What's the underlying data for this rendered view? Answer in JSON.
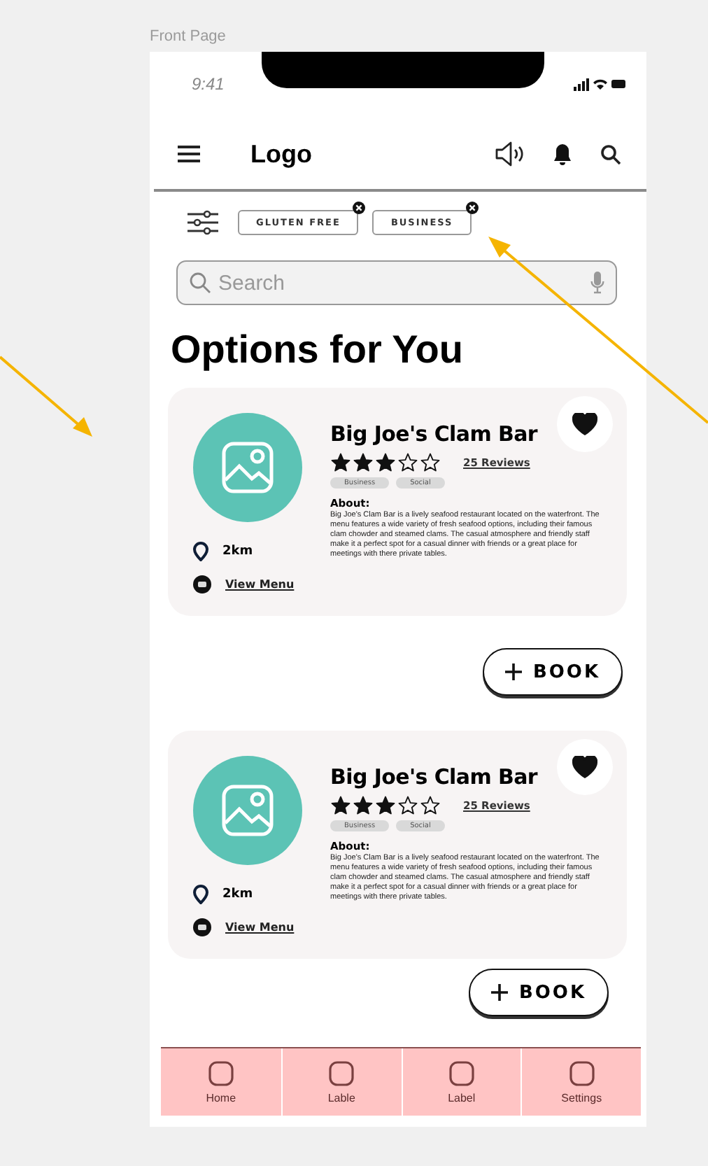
{
  "frame_label": "Front Page",
  "status_bar": {
    "time": "9:41"
  },
  "header": {
    "logo": "Logo"
  },
  "filters": [
    {
      "label": "GLUTEN FREE"
    },
    {
      "label": "BUSINESS"
    }
  ],
  "search": {
    "placeholder": "Search"
  },
  "heading": "Options for You",
  "cards": [
    {
      "name": "Big Joe's Clam Bar",
      "stars": 3,
      "reviews": "25 Reviews",
      "tags": [
        "Business",
        "Social"
      ],
      "favorite": true,
      "distance": "2km",
      "menu_link": "View Menu",
      "about_title": "About:",
      "about": "Big Joe's Clam Bar is a lively seafood restaurant located on the waterfront. The menu features a wide variety of fresh seafood options, including their famous clam chowder and steamed clams. The casual atmosphere and friendly staff make it a perfect spot for a casual dinner with friends or a great place for meetings with there private tables.",
      "book": "BOOK"
    },
    {
      "name": "Big Joe's Clam Bar",
      "stars": 3,
      "reviews": "25 Reviews",
      "tags": [
        "Business",
        "Social"
      ],
      "favorite": true,
      "distance": "2km",
      "menu_link": "View Menu",
      "about_title": "About:",
      "about": "Big Joe's Clam Bar is a lively seafood restaurant located on the waterfront. The menu features a wide variety of fresh seafood options, including their famous clam chowder and steamed clams. The casual atmosphere and friendly staff make it a perfect spot for a casual dinner with friends or a great place for meetings with there private tables.",
      "book": "BOOK"
    }
  ],
  "tab_bar": [
    {
      "label": "Home"
    },
    {
      "label": "Lable"
    },
    {
      "label": "Label"
    },
    {
      "label": "Settings"
    }
  ]
}
